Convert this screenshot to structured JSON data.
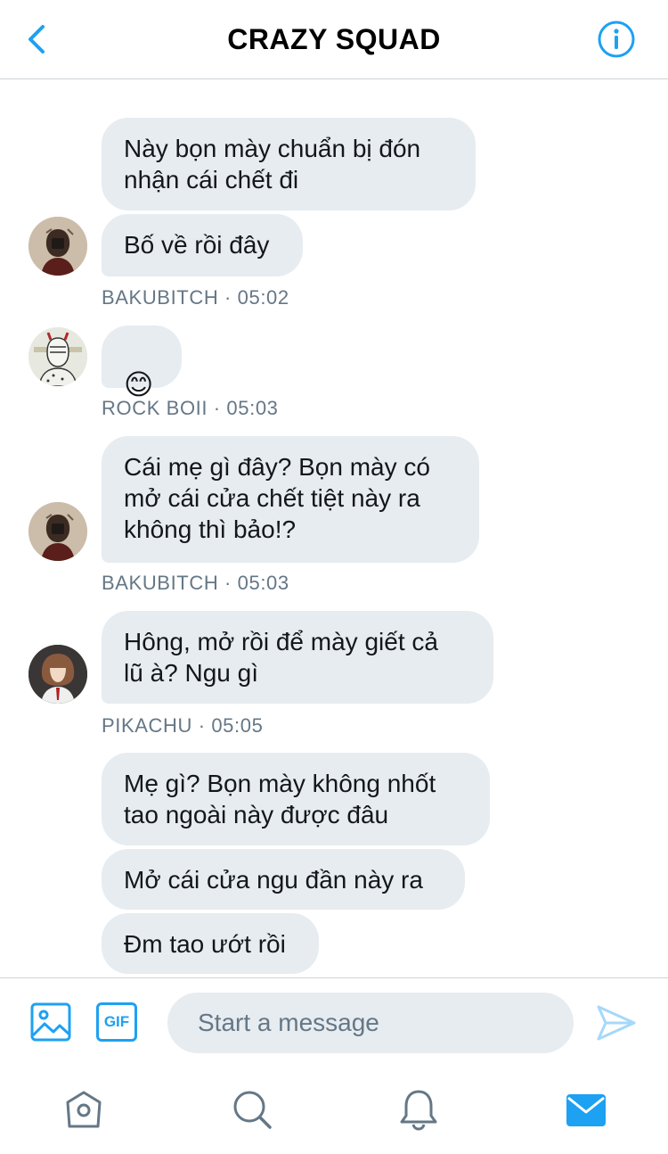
{
  "header": {
    "title": "CRAZY SQUAD",
    "back_icon": "chevron-left-icon",
    "info_icon": "info-circle-icon"
  },
  "messages": [
    {
      "sender": "BAKUBITCH",
      "time": "05:02",
      "meta": "BAKUBITCH · 05:02",
      "bubbles": [
        "Này bọn mày chuẩn bị đón\nnhận cái chết đi",
        "Bố về rồi đây"
      ]
    },
    {
      "sender": "ROCK BOII",
      "time": "05:03",
      "meta": "ROCK BOII · 05:03",
      "bubbles": [
        "😊"
      ]
    },
    {
      "sender": "BAKUBITCH",
      "time": "05:03",
      "meta": "BAKUBITCH · 05:03",
      "bubbles": [
        "Cái mẹ gì đây? Bọn mày có\nmở cái cửa chết tiệt này ra\nkhông thì bảo!?"
      ]
    },
    {
      "sender": "PIKACHU",
      "time": "05:05",
      "meta": "PIKACHU · 05:05",
      "bubbles": [
        "Hông, mở rồi để mày giết cả\nlũ à? Ngu gì"
      ]
    },
    {
      "sender": "",
      "time": "",
      "meta": "",
      "bubbles": [
        "Mẹ gì? Bọn mày không nhốt\ntao ngoài này được đâu",
        "Mở cái cửa ngu đần này ra",
        "Đm tao ướt rồi"
      ]
    }
  ],
  "composer": {
    "placeholder": "Start a message",
    "gif_label": "GIF",
    "image_icon": "image-icon",
    "send_icon": "send-icon"
  },
  "tabs": [
    {
      "name": "home",
      "icon": "home-icon"
    },
    {
      "name": "search",
      "icon": "search-icon"
    },
    {
      "name": "notifications",
      "icon": "bell-icon"
    },
    {
      "name": "messages",
      "icon": "mail-icon",
      "active": true
    }
  ],
  "colors": {
    "accent": "#1da1f2",
    "bubble_bg": "#e6ecf0",
    "meta_text": "#657786",
    "icon_gray": "#657786"
  }
}
